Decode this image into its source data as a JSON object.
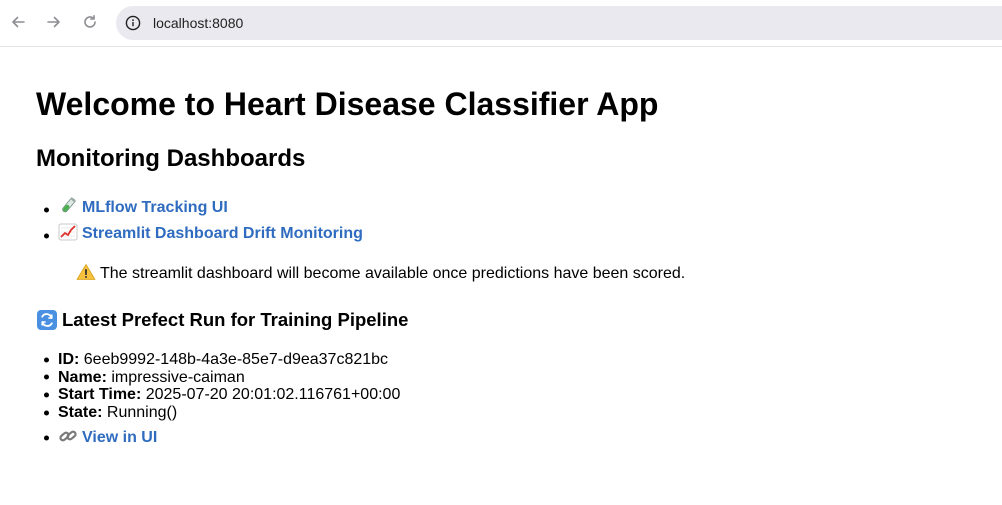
{
  "browser": {
    "url": "localhost:8080"
  },
  "page": {
    "title": "Welcome to Heart Disease Classifier App",
    "monitoring_heading": "Monitoring Dashboards",
    "dashboards": [
      {
        "icon": "test-tube-icon",
        "label": "MLflow Tracking UI"
      },
      {
        "icon": "chart-increasing-icon",
        "label": "Streamlit Dashboard Drift Monitoring"
      }
    ],
    "note": "The streamlit dashboard will become available once predictions have been scored.",
    "run_heading": "Latest Prefect Run for Training Pipeline",
    "run": {
      "id_label": "ID:",
      "id_value": "6eeb9992-148b-4a3e-85e7-d9ea37c821bc",
      "name_label": "Name:",
      "name_value": "impressive-caiman",
      "start_label": "Start Time:",
      "start_value": "2025-07-20 20:01:02.116761+00:00",
      "state_label": "State:",
      "state_value": "Running()",
      "view_link": "View in UI"
    }
  }
}
